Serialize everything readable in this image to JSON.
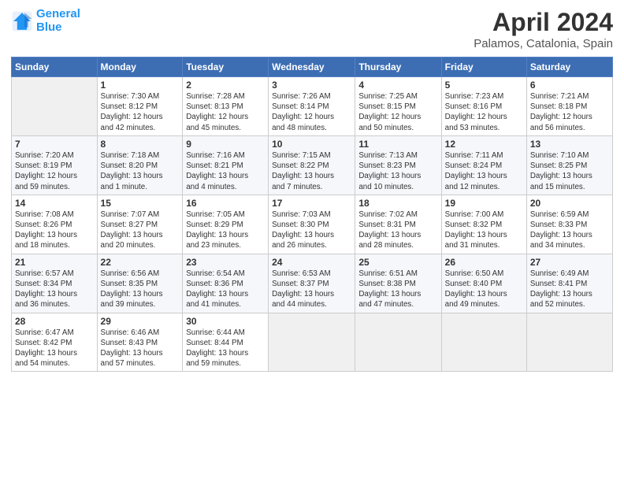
{
  "logo": {
    "line1": "General",
    "line2": "Blue"
  },
  "title": "April 2024",
  "subtitle": "Palamos, Catalonia, Spain",
  "days_header": [
    "Sunday",
    "Monday",
    "Tuesday",
    "Wednesday",
    "Thursday",
    "Friday",
    "Saturday"
  ],
  "weeks": [
    [
      {
        "day": "",
        "info": ""
      },
      {
        "day": "1",
        "info": "Sunrise: 7:30 AM\nSunset: 8:12 PM\nDaylight: 12 hours\nand 42 minutes."
      },
      {
        "day": "2",
        "info": "Sunrise: 7:28 AM\nSunset: 8:13 PM\nDaylight: 12 hours\nand 45 minutes."
      },
      {
        "day": "3",
        "info": "Sunrise: 7:26 AM\nSunset: 8:14 PM\nDaylight: 12 hours\nand 48 minutes."
      },
      {
        "day": "4",
        "info": "Sunrise: 7:25 AM\nSunset: 8:15 PM\nDaylight: 12 hours\nand 50 minutes."
      },
      {
        "day": "5",
        "info": "Sunrise: 7:23 AM\nSunset: 8:16 PM\nDaylight: 12 hours\nand 53 minutes."
      },
      {
        "day": "6",
        "info": "Sunrise: 7:21 AM\nSunset: 8:18 PM\nDaylight: 12 hours\nand 56 minutes."
      }
    ],
    [
      {
        "day": "7",
        "info": "Sunrise: 7:20 AM\nSunset: 8:19 PM\nDaylight: 12 hours\nand 59 minutes."
      },
      {
        "day": "8",
        "info": "Sunrise: 7:18 AM\nSunset: 8:20 PM\nDaylight: 13 hours\nand 1 minute."
      },
      {
        "day": "9",
        "info": "Sunrise: 7:16 AM\nSunset: 8:21 PM\nDaylight: 13 hours\nand 4 minutes."
      },
      {
        "day": "10",
        "info": "Sunrise: 7:15 AM\nSunset: 8:22 PM\nDaylight: 13 hours\nand 7 minutes."
      },
      {
        "day": "11",
        "info": "Sunrise: 7:13 AM\nSunset: 8:23 PM\nDaylight: 13 hours\nand 10 minutes."
      },
      {
        "day": "12",
        "info": "Sunrise: 7:11 AM\nSunset: 8:24 PM\nDaylight: 13 hours\nand 12 minutes."
      },
      {
        "day": "13",
        "info": "Sunrise: 7:10 AM\nSunset: 8:25 PM\nDaylight: 13 hours\nand 15 minutes."
      }
    ],
    [
      {
        "day": "14",
        "info": "Sunrise: 7:08 AM\nSunset: 8:26 PM\nDaylight: 13 hours\nand 18 minutes."
      },
      {
        "day": "15",
        "info": "Sunrise: 7:07 AM\nSunset: 8:27 PM\nDaylight: 13 hours\nand 20 minutes."
      },
      {
        "day": "16",
        "info": "Sunrise: 7:05 AM\nSunset: 8:29 PM\nDaylight: 13 hours\nand 23 minutes."
      },
      {
        "day": "17",
        "info": "Sunrise: 7:03 AM\nSunset: 8:30 PM\nDaylight: 13 hours\nand 26 minutes."
      },
      {
        "day": "18",
        "info": "Sunrise: 7:02 AM\nSunset: 8:31 PM\nDaylight: 13 hours\nand 28 minutes."
      },
      {
        "day": "19",
        "info": "Sunrise: 7:00 AM\nSunset: 8:32 PM\nDaylight: 13 hours\nand 31 minutes."
      },
      {
        "day": "20",
        "info": "Sunrise: 6:59 AM\nSunset: 8:33 PM\nDaylight: 13 hours\nand 34 minutes."
      }
    ],
    [
      {
        "day": "21",
        "info": "Sunrise: 6:57 AM\nSunset: 8:34 PM\nDaylight: 13 hours\nand 36 minutes."
      },
      {
        "day": "22",
        "info": "Sunrise: 6:56 AM\nSunset: 8:35 PM\nDaylight: 13 hours\nand 39 minutes."
      },
      {
        "day": "23",
        "info": "Sunrise: 6:54 AM\nSunset: 8:36 PM\nDaylight: 13 hours\nand 41 minutes."
      },
      {
        "day": "24",
        "info": "Sunrise: 6:53 AM\nSunset: 8:37 PM\nDaylight: 13 hours\nand 44 minutes."
      },
      {
        "day": "25",
        "info": "Sunrise: 6:51 AM\nSunset: 8:38 PM\nDaylight: 13 hours\nand 47 minutes."
      },
      {
        "day": "26",
        "info": "Sunrise: 6:50 AM\nSunset: 8:40 PM\nDaylight: 13 hours\nand 49 minutes."
      },
      {
        "day": "27",
        "info": "Sunrise: 6:49 AM\nSunset: 8:41 PM\nDaylight: 13 hours\nand 52 minutes."
      }
    ],
    [
      {
        "day": "28",
        "info": "Sunrise: 6:47 AM\nSunset: 8:42 PM\nDaylight: 13 hours\nand 54 minutes."
      },
      {
        "day": "29",
        "info": "Sunrise: 6:46 AM\nSunset: 8:43 PM\nDaylight: 13 hours\nand 57 minutes."
      },
      {
        "day": "30",
        "info": "Sunrise: 6:44 AM\nSunset: 8:44 PM\nDaylight: 13 hours\nand 59 minutes."
      },
      {
        "day": "",
        "info": ""
      },
      {
        "day": "",
        "info": ""
      },
      {
        "day": "",
        "info": ""
      },
      {
        "day": "",
        "info": ""
      }
    ]
  ]
}
